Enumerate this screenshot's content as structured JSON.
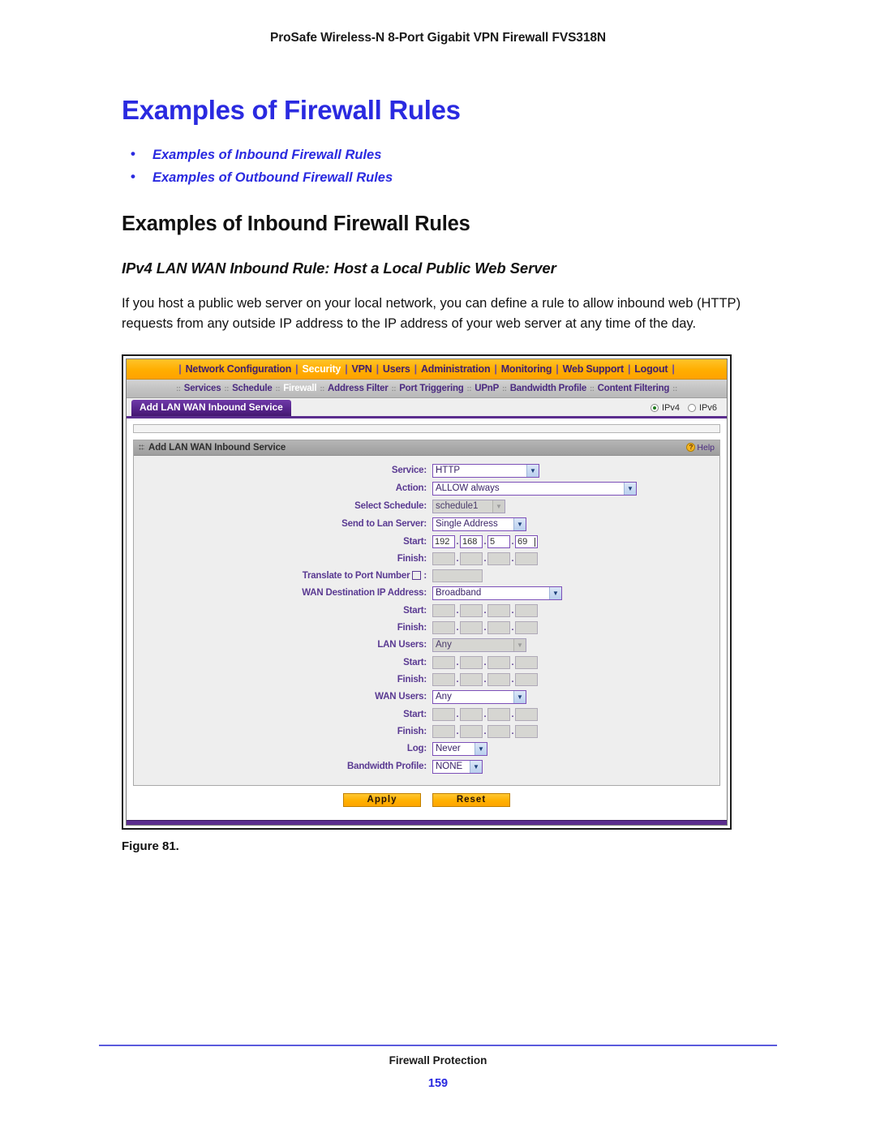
{
  "page": {
    "running_header": "ProSafe Wireless-N 8-Port Gigabit VPN Firewall FVS318N",
    "title": "Examples of Firewall Rules",
    "toc": [
      "Examples of Inbound Firewall Rules",
      "Examples of Outbound Firewall Rules"
    ],
    "section_title": "Examples of Inbound Firewall Rules",
    "subsection_title": "IPv4 LAN WAN Inbound Rule: Host a Local Public Web Server",
    "paragraph": "If you host a public web server on your local network, you can define a rule to allow inbound web (HTTP) requests from any outside IP address to the IP address of your web server at any time of the day.",
    "figure_caption": "Figure 81.",
    "footer_title": "Firewall Protection",
    "footer_page": "159"
  },
  "colors": {
    "heading_blue": "#2a2ae0",
    "nav_orange": "#ffae00",
    "tab_purple": "#55238a",
    "label_purple": "#5a3a92",
    "panel_grey": "#a8a8a8",
    "button_amber": "#ffb000"
  },
  "ui": {
    "topnav": {
      "separator": "|",
      "items": [
        {
          "label": "Network Configuration",
          "active": false
        },
        {
          "label": "Security",
          "active": true
        },
        {
          "label": "VPN",
          "active": false
        },
        {
          "label": "Users",
          "active": false
        },
        {
          "label": "Administration",
          "active": false
        },
        {
          "label": "Monitoring",
          "active": false
        },
        {
          "label": "Web Support",
          "active": false
        },
        {
          "label": "Logout",
          "active": false
        }
      ]
    },
    "subnav": {
      "separator": "::",
      "items": [
        {
          "label": "Services",
          "active": false
        },
        {
          "label": "Schedule",
          "active": false
        },
        {
          "label": "Firewall",
          "active": true
        },
        {
          "label": "Address Filter",
          "active": false
        },
        {
          "label": "Port Triggering",
          "active": false
        },
        {
          "label": "UPnP",
          "active": false
        },
        {
          "label": "Bandwidth Profile",
          "active": false
        },
        {
          "label": "Content Filtering",
          "active": false
        }
      ]
    },
    "tab_label": "Add LAN WAN Inbound Service",
    "ip_version": {
      "ipv4_label": "IPv4",
      "ipv6_label": "IPv6",
      "selected": "IPv4"
    },
    "panel": {
      "title": "Add LAN WAN Inbound Service",
      "help_label": "Help",
      "help_icon": "question-mark-icon"
    },
    "form": {
      "service": {
        "label": "Service:",
        "value": "HTTP"
      },
      "action": {
        "label": "Action:",
        "value": "ALLOW always"
      },
      "select_schedule": {
        "label": "Select Schedule:",
        "value": "schedule1",
        "disabled": true
      },
      "send_to_lan_server": {
        "label": "Send to Lan Server:",
        "value": "Single Address"
      },
      "lan_start": {
        "label": "Start:",
        "octets": [
          "192",
          "168",
          "5",
          "69"
        ]
      },
      "lan_finish": {
        "label": "Finish:",
        "octets": [
          "",
          "",
          "",
          ""
        ]
      },
      "translate_port": {
        "label": "Translate to Port Number",
        "checked": false,
        "value": ""
      },
      "wan_destination_ip": {
        "label": "WAN Destination IP Address:",
        "value": "Broadband"
      },
      "wan_dest_start": {
        "label": "Start:",
        "octets": [
          "",
          "",
          "",
          ""
        ]
      },
      "wan_dest_finish": {
        "label": "Finish:",
        "octets": [
          "",
          "",
          "",
          ""
        ]
      },
      "lan_users": {
        "label": "LAN Users:",
        "value": "Any",
        "disabled": true
      },
      "lan_users_start": {
        "label": "Start:",
        "octets": [
          "",
          "",
          "",
          ""
        ]
      },
      "lan_users_finish": {
        "label": "Finish:",
        "octets": [
          "",
          "",
          "",
          ""
        ]
      },
      "wan_users": {
        "label": "WAN Users:",
        "value": "Any"
      },
      "wan_users_start": {
        "label": "Start:",
        "octets": [
          "",
          "",
          "",
          ""
        ]
      },
      "wan_users_finish": {
        "label": "Finish:",
        "octets": [
          "",
          "",
          "",
          ""
        ]
      },
      "log": {
        "label": "Log:",
        "value": "Never"
      },
      "bandwidth_profile": {
        "label": "Bandwidth Profile:",
        "value": "NONE"
      }
    },
    "buttons": {
      "apply": "Apply",
      "reset": "Reset"
    }
  }
}
